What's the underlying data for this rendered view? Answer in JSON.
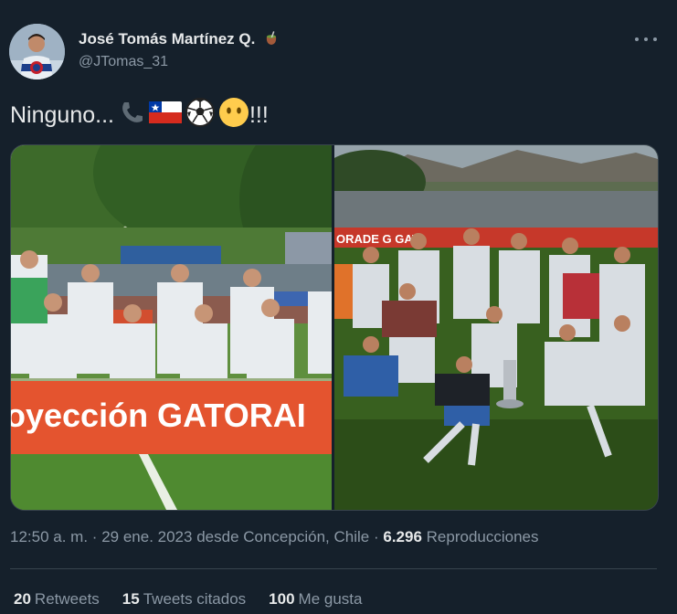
{
  "author": {
    "display_name": "José Tomás Martínez Q.",
    "handle": "@JTomas_31",
    "badge_icon": "mate-icon"
  },
  "tweet": {
    "text": "Ninguno...",
    "emojis": [
      "phone-receiver-icon",
      "chile-flag-icon",
      "soccer-ball-icon",
      "face-without-mouth-icon"
    ],
    "suffix": "!!!"
  },
  "media": {
    "left_banner_text": "oyección GATORAI",
    "right_banner_text": "ORADE G GAT"
  },
  "meta": {
    "time": "12:50 a. m.",
    "sep1": "·",
    "date": "29 ene. 2023",
    "source": "desde Concepción, Chile",
    "sep2": "·",
    "views": "6.296",
    "views_label": "Reproducciones"
  },
  "stats": [
    {
      "count": "20",
      "label": "Retweets"
    },
    {
      "count": "15",
      "label": "Tweets citados"
    },
    {
      "count": "100",
      "label": "Me gusta"
    }
  ],
  "colors": {
    "background": "#15202b",
    "text": "#e7e9ea",
    "secondary": "#8b98a5",
    "border": "#38444d",
    "banner_orange": "#e4542f"
  }
}
